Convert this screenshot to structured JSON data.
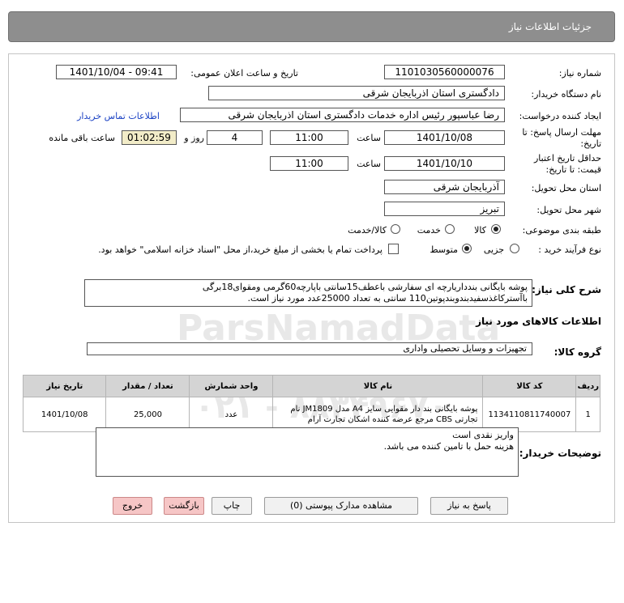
{
  "header": {
    "title": "جزئیات اطلاعات نیاز"
  },
  "fields": {
    "need_number_label": "شماره نیاز:",
    "need_number": "1101030560000076",
    "announce_label": "تاریخ و ساعت اعلان عمومی:",
    "announce_value": "1401/10/04 - 09:41",
    "buyer_label": "نام دستگاه خریدار:",
    "buyer_value": "دادگستری استان اذربایجان شرقی",
    "creator_label": "ایجاد کننده درخواست:",
    "creator_value": "رضا عباسپور رئیس اداره خدمات دادگستری استان اذربایجان شرقی",
    "contact_link": "اطلاعات تماس خریدار",
    "deadline_label_1": "مهلت ارسال پاسخ: تا",
    "deadline_label_2": "تاریخ:",
    "deadline_date": "1401/10/08",
    "time_label": "ساعت",
    "deadline_time": "11:00",
    "days_value": "4",
    "days_label": "روز و",
    "remaining_time": "01:02:59",
    "remaining_label": "ساعت باقی مانده",
    "validity_label_1": "حداقل تاریخ اعتبار",
    "validity_label_2": "قیمت: تا تاریخ:",
    "validity_date": "1401/10/10",
    "validity_time_label": "ساعت",
    "validity_time": "11:00",
    "province_label": "استان محل تحویل:",
    "province_value": "آذربایجان شرقی",
    "city_label": "شهر محل تحویل:",
    "city_value": "تبریز",
    "category_label": "طبقه بندی موضوعی:",
    "category_options": [
      "کالا",
      "خدمت",
      "کالا/خدمت"
    ],
    "category_selected": "کالا",
    "process_label": "نوع فرآیند خرید :",
    "process_options": [
      "جزیی",
      "متوسط"
    ],
    "process_selected": "متوسط",
    "treasury_text": "پرداخت تمام یا بخشی از مبلغ خرید،از محل \"اسناد خزانه اسلامی\" خواهد بود."
  },
  "summary": {
    "label": "شرح کلی نیاز:",
    "text": "پوشه بایگانی بندداریارچه ای سفارشی باعطف15سانتی باپارچه60گرمی ومقوای18برگی باآسترکاغذسفیدبندوبندپوتین110 سانتی به تعداد 25000عدد مورد نیاز است."
  },
  "goods_section": {
    "title": "اطلاعات کالاهای مورد نیاز",
    "group_label": "گروه کالا:",
    "group_value": "تجهیزات و وسایل تحصیلی واداری"
  },
  "table": {
    "headers": [
      "ردیف",
      "کد کالا",
      "نام کالا",
      "واحد شمارش",
      "تعداد / مقدار",
      "تاریخ نیاز"
    ],
    "rows": [
      {
        "index": "1",
        "code": "1134110811740007",
        "name_line1": "پوشه بایگانی بند دار مقوایی سایز A4 مدل JM1809 نام",
        "name_line2": "تجارتی CBS مرجع عرضه کننده اشکان تجارت آرام",
        "unit": "عدد",
        "qty": "25,000",
        "date": "1401/10/08"
      }
    ]
  },
  "buyer_notes": {
    "label": "توضیحات خریدار:",
    "line1": "واریز نقدی است",
    "line2": "هزینه حمل با تامین کننده می باشد."
  },
  "buttons": {
    "reply": "پاسخ به نیاز",
    "view_docs": "مشاهده مدارک پیوستی (0)",
    "print": "چاپ",
    "back": "بازگشت",
    "exit": "خروج"
  }
}
